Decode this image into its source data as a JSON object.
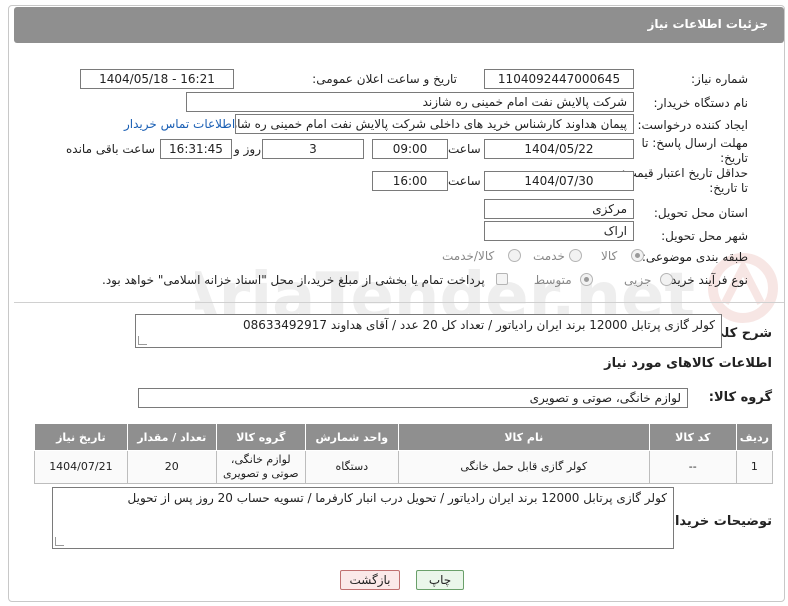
{
  "header": {
    "title": "جزئیات اطلاعات نیاز"
  },
  "form": {
    "need_number": {
      "label": "شماره نیاز:",
      "value": "1104092447000645"
    },
    "announce_datetime": {
      "label": "تاریخ و ساعت اعلان عمومی:",
      "value": "1404/05/18 - 16:21"
    },
    "buyer_org": {
      "label": "نام دستگاه خریدار:",
      "value": "شرکت پالایش نفت امام خمینی  ره  شازند"
    },
    "requester": {
      "label": "ایجاد کننده درخواست:",
      "value": "پیمان هداوند کارشناس خرید های داخلی  شرکت پالایش نفت امام خمینی  ره  شازند",
      "contact_link": "اطلاعات تماس خریدار"
    },
    "reply_deadline": {
      "label_line1": "مهلت ارسال پاسخ: تا",
      "label_line2": "تاریخ:",
      "date": "1404/05/22",
      "time_label": "ساعت",
      "time": "09:00",
      "days": "3",
      "days_label": "روز و",
      "remaining": "16:31:45",
      "remaining_label": "ساعت باقی مانده"
    },
    "price_validity": {
      "label_line1": "حداقل تاریخ اعتبار قیمت:",
      "label_line2": "تا تاریخ:",
      "date": "1404/07/30",
      "time_label": "ساعت",
      "time": "16:00"
    },
    "delivery_province": {
      "label": "استان محل تحویل:",
      "value": "مرکزی"
    },
    "delivery_city": {
      "label": "شهر محل تحویل:",
      "value": "اراک"
    },
    "category": {
      "label": "طبقه بندی موضوعی:",
      "options": [
        "کالا",
        "خدمت",
        "کالا/خدمت"
      ],
      "selected": "کالا"
    },
    "purchase_process": {
      "label": "نوع فرآیند خرید :",
      "options": [
        "جزیی",
        "متوسط"
      ],
      "selected": "متوسط",
      "payment_note": "پرداخت تمام یا بخشی از مبلغ خرید،از محل \"اسناد خزانه اسلامی\" خواهد بود."
    },
    "general_description": {
      "label": "شرح کلی نیاز:",
      "value": "کولر گازی پرتابل 12000 برند ایران رادیاتور / تعداد کل 20 عدد / آقای هداوند 08633492917"
    }
  },
  "goods_section": {
    "title": "اطلاعات کالاهای مورد نیاز",
    "group_label": "گروه کالا:",
    "group_value": "لوازم خانگی، صوتی و تصویری",
    "table": {
      "columns": [
        "ردیف",
        "کد کالا",
        "نام کالا",
        "واحد شمارش",
        "گروه کالا",
        "تعداد / مقدار",
        "تاریخ نیاز"
      ],
      "rows": [
        {
          "index": "1",
          "code": "--",
          "name": "کولر گازی قابل حمل خانگی",
          "unit": "دستگاه",
          "group": "لوازم خانگی، صوتی و تصویری",
          "qty": "20",
          "date": "1404/07/21"
        }
      ]
    }
  },
  "buyer_notes": {
    "label": "توضیحات خریدار:",
    "value": "کولر گازی پرتابل 12000 برند ایران رادیاتور / تحویل درب انبار کارفرما / تسویه حساب 20 روز پس از تحویل"
  },
  "buttons": {
    "print": "چاپ",
    "back": "بازگشت"
  },
  "watermark": {
    "text": "AriaTender.net"
  }
}
